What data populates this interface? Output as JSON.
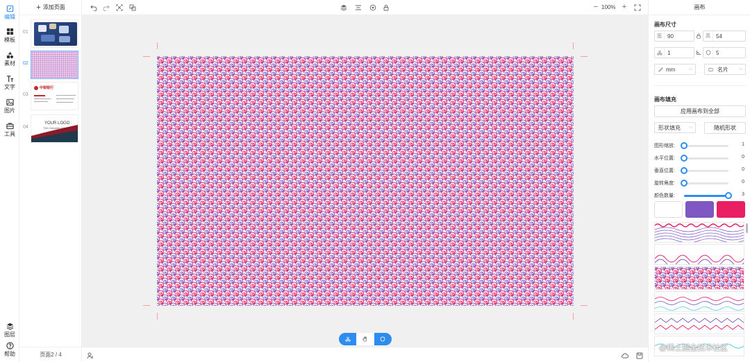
{
  "nav": {
    "items": [
      {
        "label": "编辑",
        "icon": "edit-icon"
      },
      {
        "label": "模板",
        "icon": "template-icon"
      },
      {
        "label": "素材",
        "icon": "shapes-icon"
      },
      {
        "label": "文字",
        "icon": "text-icon"
      },
      {
        "label": "图片",
        "icon": "image-icon"
      },
      {
        "label": "工具",
        "icon": "toolbox-icon"
      },
      {
        "label": "图层",
        "icon": "layers-icon"
      },
      {
        "label": "帮助",
        "icon": "help-icon"
      }
    ]
  },
  "pages": {
    "add_label": "添加页面",
    "items": [
      {
        "num": "01"
      },
      {
        "num": "02"
      },
      {
        "num": "03",
        "logo_text": "中银银行"
      },
      {
        "num": "04",
        "logo": "YOUR LOGO",
        "company": "The Company Name"
      }
    ],
    "indicator": "页面2 / 4"
  },
  "toolbar": {
    "zoom_minus": "−",
    "zoom": "100%",
    "zoom_plus": "+"
  },
  "panel": {
    "title": "画布",
    "size_title": "画布尺寸",
    "width_prefix": "宽",
    "width": "90",
    "height_prefix": "高",
    "height": "54",
    "bleed": "1",
    "corner": "5",
    "unit": "mm",
    "preset": "名片",
    "fill_title": "画布填充",
    "apply_all": "应用画布到全部",
    "fill_type": "形状填充",
    "random_shape": "随机形状",
    "sliders": [
      {
        "label": "图形缩放:",
        "value": "1",
        "fraction": 0
      },
      {
        "label": "水平位置:",
        "value": "0",
        "fraction": 0
      },
      {
        "label": "垂直位置:",
        "value": "0",
        "fraction": 0
      },
      {
        "label": "旋转角度:",
        "value": "0",
        "fraction": 0
      },
      {
        "label": "颜色数量:",
        "value": "3",
        "fraction": 1
      }
    ],
    "colors": [
      "#ffffff",
      "#7e57c2",
      "#e91e63"
    ]
  },
  "colors": {
    "accent": "#2d8cf0",
    "pattern_pink": "#e91e63",
    "pattern_purple": "#7e57c2"
  },
  "watermark": "@稀土掘金技术社区"
}
